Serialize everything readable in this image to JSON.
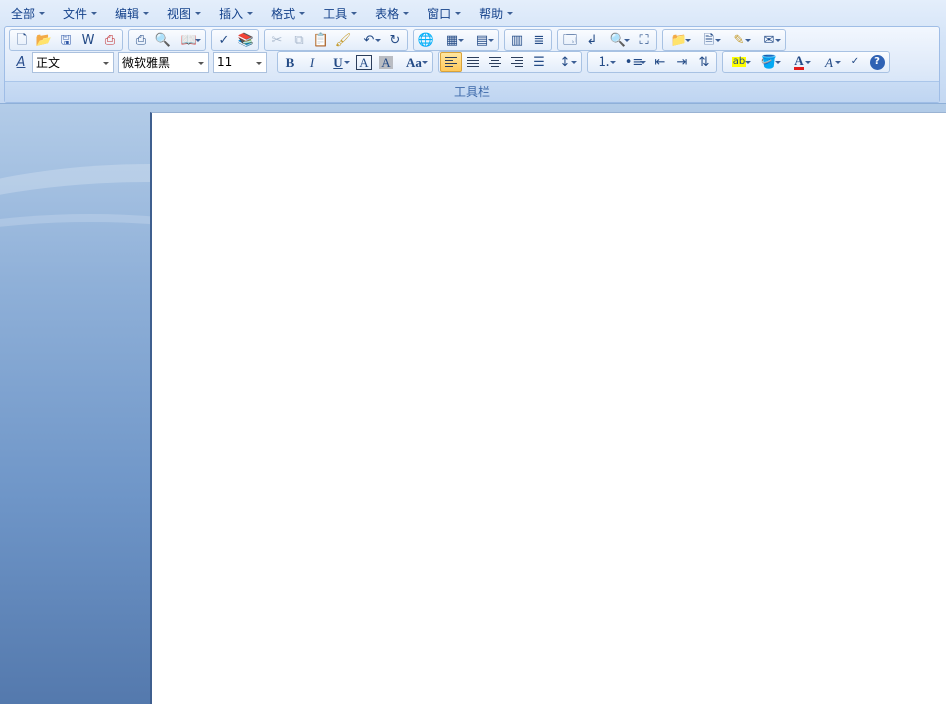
{
  "menubar": {
    "items": [
      {
        "label": "全部"
      },
      {
        "label": "文件"
      },
      {
        "label": "编辑"
      },
      {
        "label": "视图"
      },
      {
        "label": "插入"
      },
      {
        "label": "格式"
      },
      {
        "label": "工具"
      },
      {
        "label": "表格"
      },
      {
        "label": "窗口"
      },
      {
        "label": "帮助"
      }
    ]
  },
  "toolbar": {
    "panel_label": "工具栏",
    "style_value": "正文",
    "font_value": "微软雅黑",
    "size_value": "11",
    "bold_glyph": "B",
    "italic_glyph": "I",
    "underline_glyph": "U",
    "char_border_glyph": "A",
    "char_shading_glyph": "A",
    "change_case_glyph": "Aa",
    "font_color_glyph": "A",
    "text_effect_glyph": "A",
    "highlight_glyph": "ab",
    "styles_glyph": "A"
  },
  "colors": {
    "menu_text": "#15428b",
    "ribbon_bg": "#d3e3f7",
    "workspace_bg": "#6f96c8",
    "font_color_accent": "#e21c1c",
    "highlight_accent": "#ffff00"
  }
}
